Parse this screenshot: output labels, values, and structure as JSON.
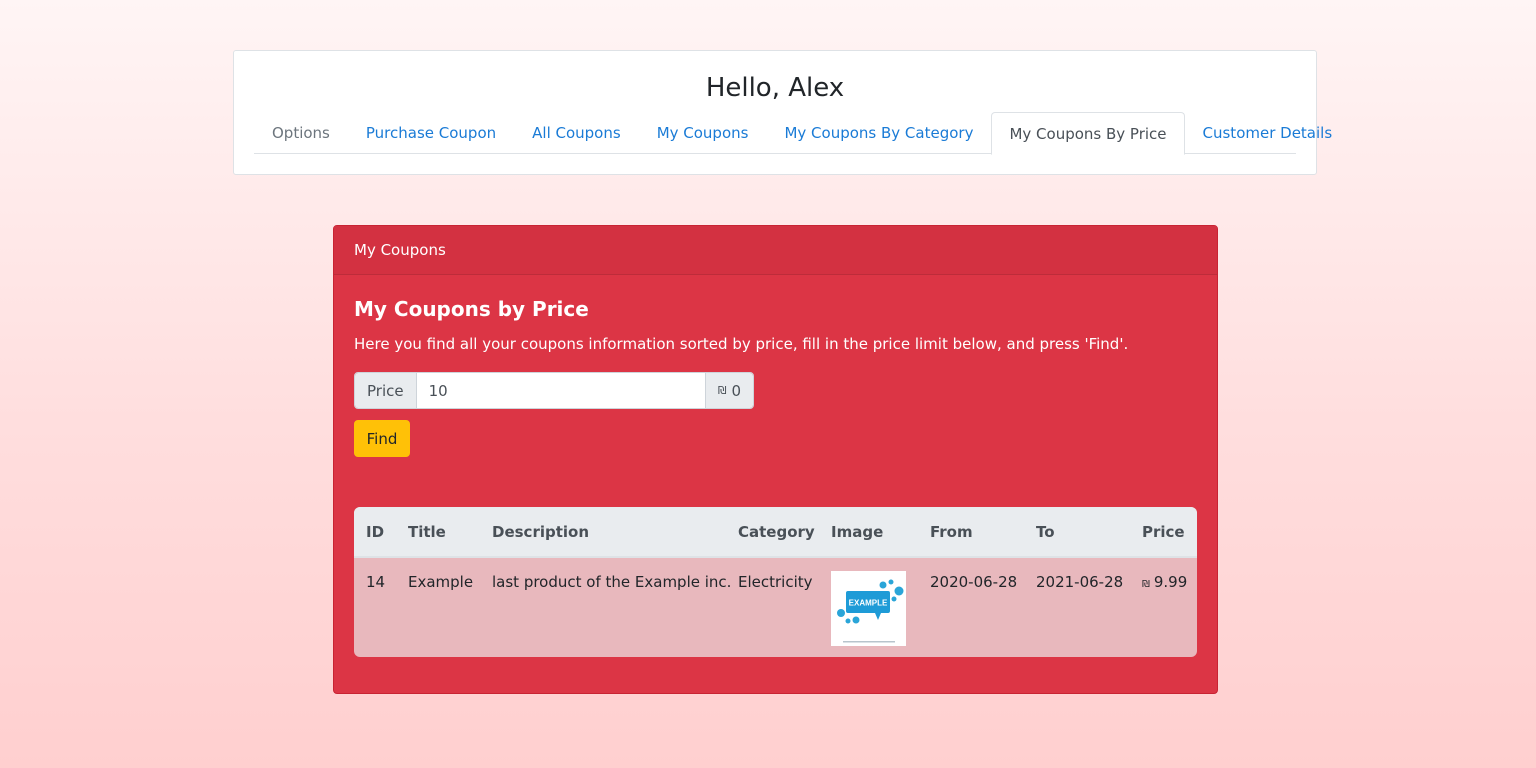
{
  "header": {
    "greeting": "Hello, Alex",
    "tabs": [
      {
        "label": "Options"
      },
      {
        "label": "Purchase Coupon"
      },
      {
        "label": "All Coupons"
      },
      {
        "label": "My Coupons"
      },
      {
        "label": "My Coupons By Category"
      },
      {
        "label": "My Coupons By Price",
        "active": true
      },
      {
        "label": "Customer Details"
      }
    ]
  },
  "panel": {
    "header": "My Coupons",
    "title": "My Coupons by Price",
    "description": "Here you find all your coupons information sorted by price, fill in the price limit below, and press 'Find'.",
    "price_label": "Price",
    "price_value": "10",
    "currency_symbol": "₪",
    "currency_suffix": "0",
    "find_label": "Find"
  },
  "table": {
    "headers": {
      "id": "ID",
      "title": "Title",
      "description": "Description",
      "category": "Category",
      "image": "Image",
      "from": "From",
      "to": "To",
      "price": "Price"
    },
    "rows": [
      {
        "id": "14",
        "title": "Example",
        "description": "last product of the Example inc.",
        "category": "Electricity",
        "image_icon": "example-logo-image",
        "image_text": "EXAMPLE",
        "from": "2020-06-28",
        "to": "2021-06-28",
        "currency_symbol": "₪",
        "price": "9.99"
      }
    ]
  },
  "colors": {
    "panel_bg": "#dc3545",
    "link": "#1a7bd6",
    "find_button": "#ffc107",
    "row_bg": "#e8b8bd"
  }
}
